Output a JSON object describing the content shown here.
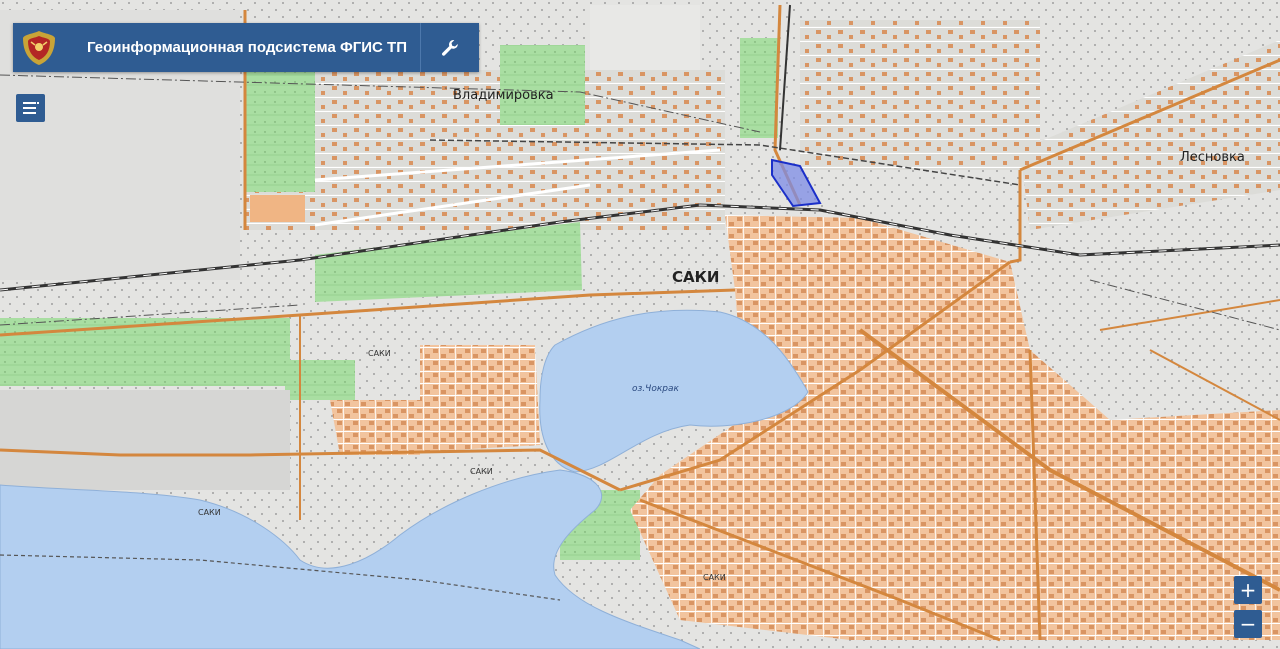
{
  "header": {
    "title": "Геоинформационная подсистема ФГИС ТП",
    "emblem_icon": "coat-of-arms-icon",
    "tools_icon": "wrench-icon"
  },
  "sidebar": {
    "menu_icon": "layers-menu-icon"
  },
  "zoom": {
    "in_label": "+",
    "out_label": "−"
  },
  "map": {
    "labels": {
      "saki_main": "САКИ",
      "vladimirovka": "Владимировка",
      "lesnovka": "Лесновка",
      "lake": "оз.Чокрак",
      "saki_small_1": "САКИ",
      "saki_small_2": "САКИ",
      "saki_small_3": "САКИ",
      "saki_small_4": "САКИ"
    },
    "colors": {
      "background": "#e4e4e2",
      "water": "#b3cff0",
      "urban": "#f2c49e",
      "buildings": "#d99563",
      "greenery": "#a9dea2",
      "roads": "#d4873e",
      "railway": "#333333",
      "highlight_fill": "#7d8ce6",
      "highlight_stroke": "#1b2fc9"
    }
  }
}
